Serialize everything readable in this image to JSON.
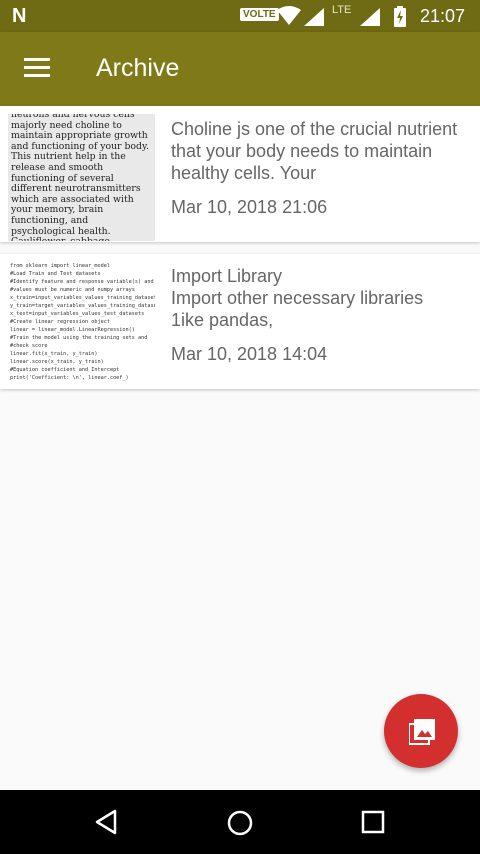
{
  "status_bar": {
    "notification_icon": "N",
    "volte": "VOLTE",
    "lte": "LTE",
    "time": "21:07"
  },
  "app_bar": {
    "title": "Archive",
    "menu_icon": "hamburger-menu-icon"
  },
  "notes": [
    {
      "thumbnail_text": "neurons and nervous cells majorly need choline to maintain appropriate growth and functioning of your body. This nutrient help in the release and smooth functioning of several different neurotransmitters which are associated with your memory, brain functioning, and psychological health. Cauliflower, cabbage",
      "text": "Choline js one of the crucial nutrient that your body needs to maintain healthy cells. Your",
      "date": "Mar 10, 2018 21:06"
    },
    {
      "thumbnail_text": "from sklearn import linear_model\n#Load Train and Test datasets\n#Identify feature and response variable(s) and\n#values must be numeric and numpy arrays\nx_train=input_variables_values_training_datasets\ny_train=target_variables_values_training_datasets\nx_test=input_variables_values_test_datasets\n#Create linear regression object\nlinear = linear_model.LinearRegression()\n#Train the model using the training sets and\n#check score\nlinear.fit(x_train, y_train)\nlinear.score(x_train, y_train)\n#Equation coefficient and Intercept\nprint('Coefficient: \\n', linear.coef_)",
      "title": "Import Library",
      "text": "Import other necessary libraries 1ike pandas,",
      "date": "Mar 10, 2018 14:04"
    }
  ],
  "fab": {
    "icon": "add-image-icon",
    "color": "#d32f2f"
  },
  "colors": {
    "app_bar": "#807918",
    "status_bar": "#6f6a14",
    "background": "#fafafa"
  }
}
